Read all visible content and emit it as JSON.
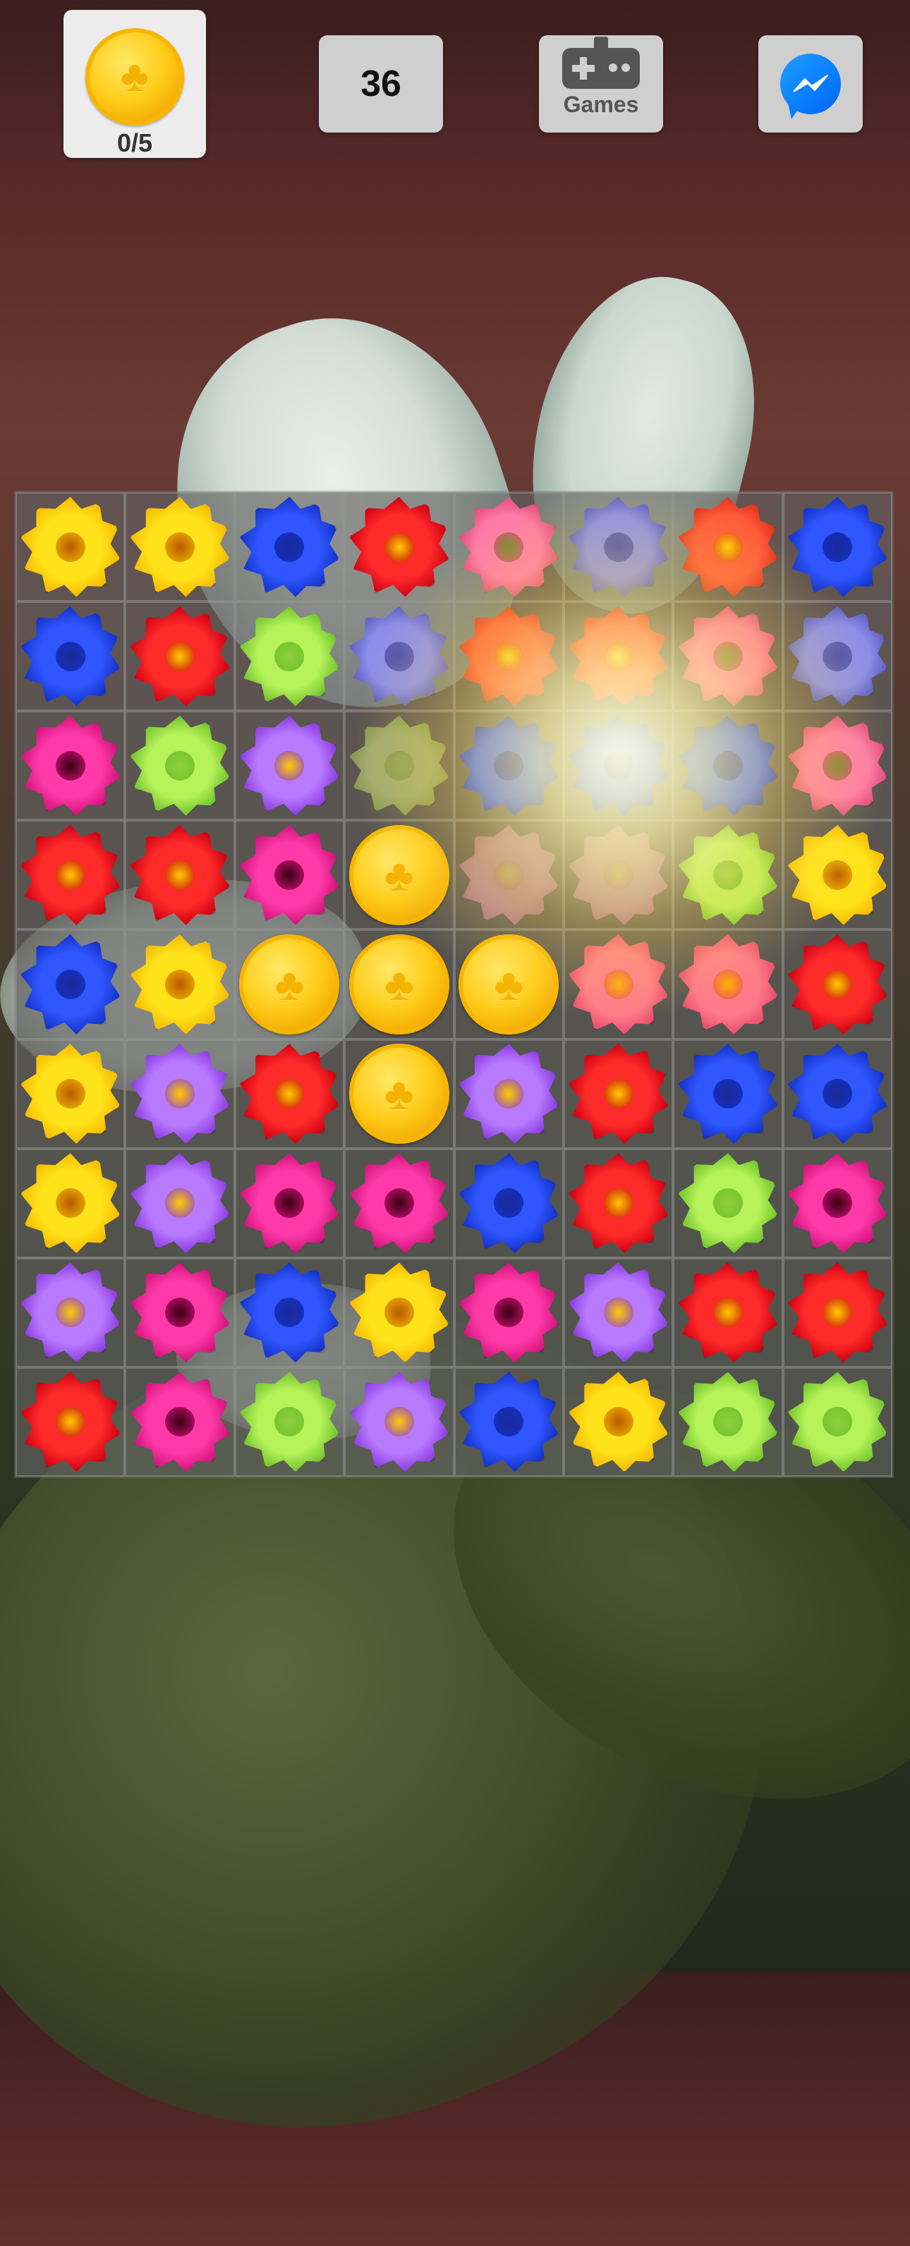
{
  "hud": {
    "goal_icon": "gold-clover-coin",
    "goal_text": "0/5",
    "moves": "36",
    "games_label": "Games",
    "games_icon": "gamepad-icon",
    "share_icon": "messenger-icon"
  },
  "board": {
    "rows": 9,
    "cols": 8,
    "grid": [
      [
        "yellow",
        "yellow",
        "blue",
        "red",
        "pink",
        "lavender",
        "orange",
        "blue"
      ],
      [
        "blue",
        "red",
        "green",
        "lavender",
        "orange",
        "orange",
        "pink",
        "lavender"
      ],
      [
        "magenta",
        "green",
        "purple",
        "green-faded",
        "blue",
        "blue",
        "blue",
        "pink"
      ],
      [
        "red",
        "red",
        "magenta",
        "coin",
        "pink-faded",
        "pink-faded",
        "green",
        "yellow"
      ],
      [
        "blue",
        "yellow",
        "coin",
        "coin",
        "coin",
        "salmon",
        "salmon",
        "red"
      ],
      [
        "yellow",
        "purple",
        "red",
        "coin",
        "purple",
        "red",
        "blue",
        "blue"
      ],
      [
        "yellow",
        "purple",
        "magenta",
        "magenta",
        "blue",
        "red",
        "green",
        "magenta"
      ],
      [
        "purple",
        "magenta",
        "blue",
        "yellow",
        "magenta",
        "purple",
        "red",
        "red"
      ],
      [
        "red",
        "magenta",
        "green",
        "purple",
        "blue",
        "yellow",
        "green",
        "green"
      ]
    ],
    "colors": {
      "yellow": [
        "#ffe31a",
        "#f5b800",
        "#b85a00"
      ],
      "blue": [
        "#2f56ff",
        "#1230c4",
        "#1b2a9a"
      ],
      "red": [
        "#ff2a2a",
        "#cc0010",
        "#ffcc00"
      ],
      "pink": [
        "#ff7aa8",
        "#e04a7c",
        "#6e8a30"
      ],
      "lavender": [
        "#8d8ee8",
        "#5d5fc2",
        "#4a4ca8"
      ],
      "orange": [
        "#ff5a3a",
        "#e0301c",
        "#ffd000"
      ],
      "green": [
        "#b6f25a",
        "#6fc22a",
        "#8fd040"
      ],
      "magenta": [
        "#ff3aa8",
        "#d0107a",
        "#3a0010"
      ],
      "purple": [
        "#b87aff",
        "#8a3ae0",
        "#ffcc00"
      ],
      "salmon": [
        "#ff7a8a",
        "#ea4a6a",
        "#ffb000"
      ],
      "green-faded": [
        "#d9f08a",
        "#a8d04a",
        "#b8e060"
      ],
      "pink-faded": [
        "#f5a8d0",
        "#e27ab8",
        "#ffe070"
      ]
    }
  }
}
